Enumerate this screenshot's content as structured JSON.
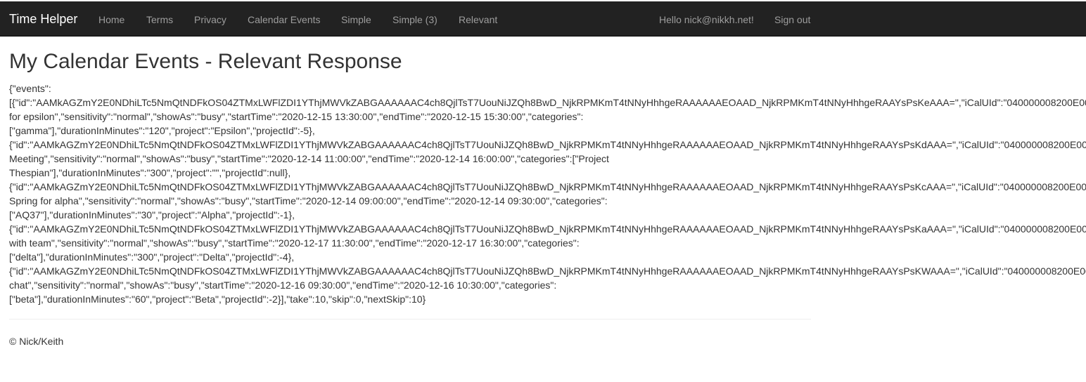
{
  "navbar": {
    "brand": "Time Helper",
    "links": [
      "Home",
      "Terms",
      "Privacy",
      "Calendar Events",
      "Simple",
      "Simple (3)",
      "Relevant"
    ],
    "greeting": "Hello nick@nikkh.net!",
    "sign_out": "Sign out"
  },
  "main": {
    "title": "My Calendar Events - Relevant Response",
    "json_lines": [
      "{\"events\":",
      "[{\"id\":\"AAMkAGZmY2E0NDhiLTc5NmQtNDFkOS04ZTMxLWFlZDI1YThjMWVkZABGAAAAAAC4ch8QjlTsT7UouNiJZQh8BwD_NjkRPMKmT4tNNyHhhgeRAAAAAAEOAAD_NjkRPMKmT4tNNyHhhgeRAAYsPsKeAAA=\",\"iCalUId\":\"040000008200E00",
      "for epsilon\",\"sensitivity\":\"normal\",\"showAs\":\"busy\",\"startTime\":\"2020-12-15 13:30:00\",\"endTime\":\"2020-12-15 15:30:00\",\"categories\":",
      "[\"gamma\"],\"durationInMinutes\":\"120\",\"project\":\"Epsilon\",\"projectId\":-5},",
      "{\"id\":\"AAMkAGZmY2E0NDhiLTc5NmQtNDFkOS04ZTMxLWFlZDI1YThjMWVkZABGAAAAAAC4ch8QjlTsT7UouNiJZQh8BwD_NjkRPMKmT4tNNyHhhgeRAAAAAAEOAAD_NjkRPMKmT4tNNyHhhgeRAAYsPsKdAAA=\",\"iCalUId\":\"040000008200E00",
      "Meeting\",\"sensitivity\":\"normal\",\"showAs\":\"busy\",\"startTime\":\"2020-12-14 11:00:00\",\"endTime\":\"2020-12-14 16:00:00\",\"categories\":[\"Project",
      "Thespian\"],\"durationInMinutes\":\"300\",\"project\":\"\",\"projectId\":null},",
      "{\"id\":\"AAMkAGZmY2E0NDhiLTc5NmQtNDFkOS04ZTMxLWFlZDI1YThjMWVkZABGAAAAAAC4ch8QjlTsT7UouNiJZQh8BwD_NjkRPMKmT4tNNyHhhgeRAAAAAAEOAAD_NjkRPMKmT4tNNyHhhgeRAAYsPsKcAAA=\",\"iCalUId\":\"040000008200E00",
      "Spring for alpha\",\"sensitivity\":\"normal\",\"showAs\":\"busy\",\"startTime\":\"2020-12-14 09:00:00\",\"endTime\":\"2020-12-14 09:30:00\",\"categories\":",
      "[\"AQ37\"],\"durationInMinutes\":\"30\",\"project\":\"Alpha\",\"projectId\":-1},",
      "{\"id\":\"AAMkAGZmY2E0NDhiLTc5NmQtNDFkOS04ZTMxLWFlZDI1YThjMWVkZABGAAAAAAC4ch8QjlTsT7UouNiJZQh8BwD_NjkRPMKmT4tNNyHhhgeRAAAAAAEOAAD_NjkRPMKmT4tNNyHhhgeRAAYsPsKaAAA=\",\"iCalUId\":\"040000008200E00",
      "with team\",\"sensitivity\":\"normal\",\"showAs\":\"busy\",\"startTime\":\"2020-12-17 11:30:00\",\"endTime\":\"2020-12-17 16:30:00\",\"categories\":",
      "[\"delta\"],\"durationInMinutes\":\"300\",\"project\":\"Delta\",\"projectId\":-4},",
      "{\"id\":\"AAMkAGZmY2E0NDhiLTc5NmQtNDFkOS04ZTMxLWFlZDI1YThjMWVkZABGAAAAAAC4ch8QjlTsT7UouNiJZQh8BwD_NjkRPMKmT4tNNyHhhgeRAAAAAAEOAAD_NjkRPMKmT4tNNyHhhgeRAAYsPsKWAAA=\",\"iCalUId\":\"040000008200E00",
      "chat\",\"sensitivity\":\"normal\",\"showAs\":\"busy\",\"startTime\":\"2020-12-16 09:30:00\",\"endTime\":\"2020-12-16 10:30:00\",\"categories\":",
      "[\"beta\"],\"durationInMinutes\":\"60\",\"project\":\"Beta\",\"projectId\":-2}],\"take\":10,\"skip\":0,\"nextSkip\":10}"
    ]
  },
  "footer": {
    "text": "© Nick/Keith"
  }
}
